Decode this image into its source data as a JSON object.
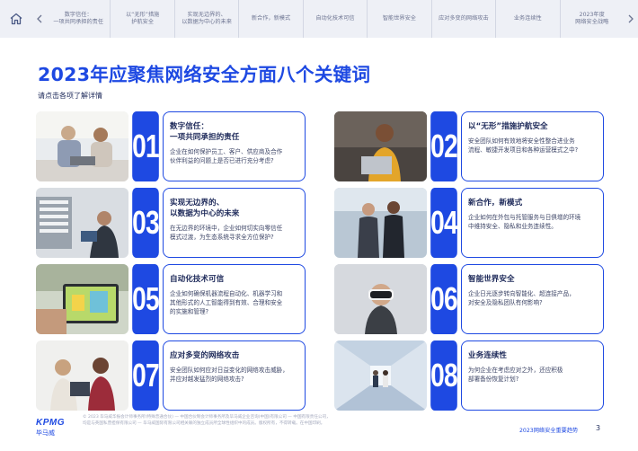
{
  "nav": {
    "home_icon": "home-icon",
    "prev_icon": "chevron-left-icon",
    "next_icon": "chevron-right-icon",
    "tabs": [
      {
        "label": "数字信任：\n一项共同承担的责任"
      },
      {
        "label": "以“无形”措施\n护航安全"
      },
      {
        "label": "实现无边界的、\n以数据为中心的未来"
      },
      {
        "label": "新合作，新模式"
      },
      {
        "label": "自动化技术可信"
      },
      {
        "label": "智能世界安全"
      },
      {
        "label": "应对多变的网络攻击"
      },
      {
        "label": "业务连续性"
      },
      {
        "label": "2023年度\n网络安全战略"
      }
    ]
  },
  "page": {
    "title": "2023年应聚焦网络安全方面八个关键词",
    "subtitle": "请点击各项了解详情"
  },
  "cards": [
    {
      "number": "01",
      "title": "数字信任：\n一项共同承担的责任",
      "desc": "企业在如何保护员工、客户、供应商及合作\n伙伴利益的问题上是否已进行充分考虑?"
    },
    {
      "number": "02",
      "title": "以“无形”措施护航安全",
      "desc": "安全团队如何有效地将安全性整合进业务\n流程、敏捷开发项目和各种运营模式之中?"
    },
    {
      "number": "03",
      "title": "实现无边界的、\n以数据为中心的未来",
      "desc": "在无边界的环境中，企业如何切实向零信任\n模式过渡，为生态系统寻求全方位保护?"
    },
    {
      "number": "04",
      "title": "新合作，新模式",
      "desc": "企业如何在外包与托管服务与日俱增的环境\n中维持安全、隐私和业务连续性。"
    },
    {
      "number": "05",
      "title": "自动化技术可信",
      "desc": "企业如何确保机器流程自动化、机器学习和\n其他形式的人工智能得到有效、合理和安全\n的实施和管理?"
    },
    {
      "number": "06",
      "title": "智能世界安全",
      "desc": "企业日光逐步转向智能化、超连接产品，\n对安全及隐私团队有何影响?"
    },
    {
      "number": "07",
      "title": "应对多变的网络攻击",
      "desc": "安全团队如何应对日益变化的网络攻击威胁，\n并应对越发猛烈的网络攻击?"
    },
    {
      "number": "08",
      "title": "业务连续性",
      "desc": "为何企业在考虑应对之外，还应积极\n部署备份恢复计划?"
    }
  ],
  "footer": {
    "logo": "KPMG",
    "logo_cn": "毕马威",
    "note": "© 2023 毕马威华振会计师事务所(特殊普通合伙) — 中国合伙制会计师事务所及毕马威企业咨询(中国)有限公司 — 中国有限责任公司，\n均是与英国私营担保有限公司 — 毕马威国际有限公司相关联的独立成员所全球性组织中的成员。版权所有，不得转载。在中国印刷。",
    "report_name": "2023网络安全重要趋势",
    "page_number": "3"
  },
  "colors": {
    "accent": "#1e49e2",
    "nav_bg": "#eef0f6",
    "text": "#1e2a5a"
  }
}
